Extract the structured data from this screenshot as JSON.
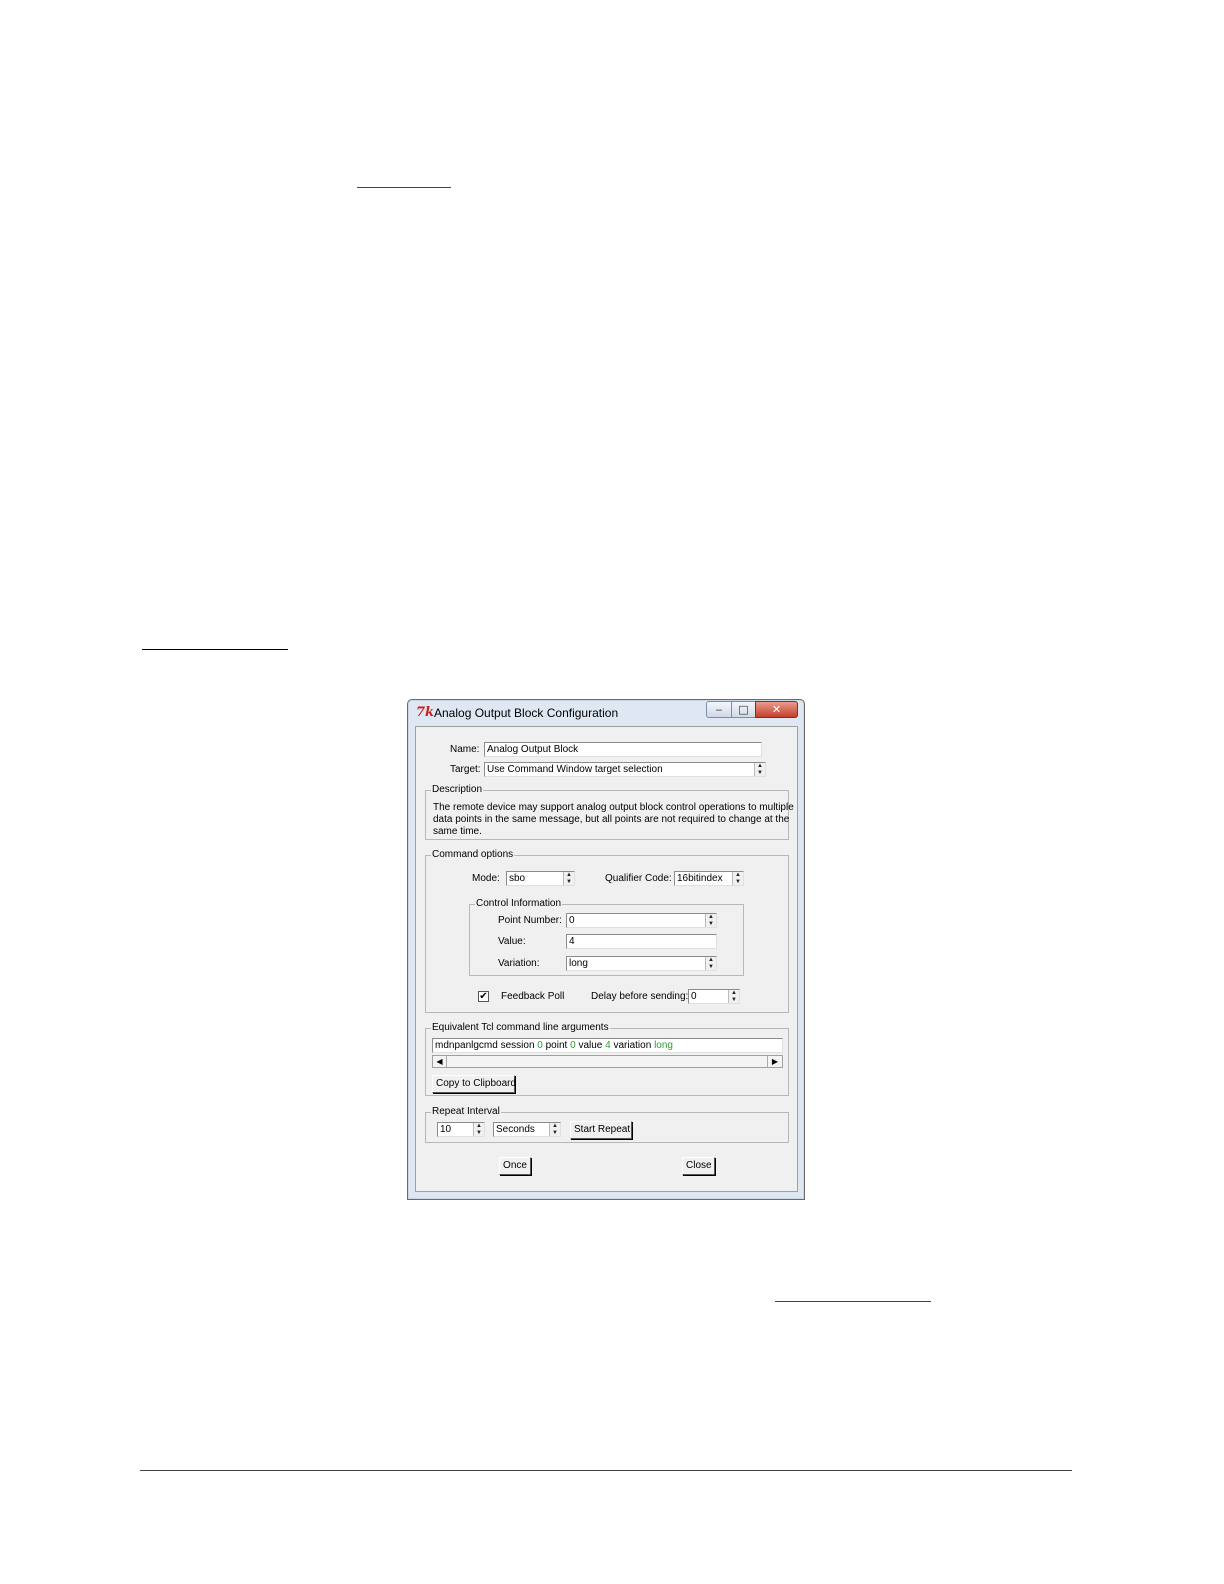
{
  "window": {
    "title": "Analog Output Block Configuration",
    "icon": "tk-feather-icon",
    "controls": {
      "minimize": "‒",
      "maximize": "□",
      "close": "✕"
    }
  },
  "form": {
    "name_label": "Name:",
    "name_value": "Analog Output Block",
    "target_label": "Target:",
    "target_value": "Use Command Window target selection"
  },
  "description": {
    "title": "Description",
    "lines": [
      "The remote device may support analog output block control operations to multiple",
      "data points  in the same message, but all points are not required to change at the",
      "same time."
    ]
  },
  "command_options": {
    "title": "Command options",
    "mode_label": "Mode:",
    "mode_value": "sbo",
    "qualifier_label": "Qualifier Code:",
    "qualifier_value": "16bitindex",
    "control_info": {
      "title": "Control Information",
      "point_label": "Point Number:",
      "point_value": "0",
      "value_label": "Value:",
      "value_value": "4",
      "variation_label": "Variation:",
      "variation_value": "long"
    },
    "feedback_poll_label": "Feedback Poll",
    "feedback_poll_checked": "✔",
    "delay_label": "Delay before sending:",
    "delay_value": "0"
  },
  "tcl": {
    "title": "Equivalent Tcl command line arguments",
    "cmd": "mdnpanlgcmd",
    "session_kw": "session",
    "session_val": "0",
    "point_kw": "point",
    "point_val": "0",
    "value_kw": "value",
    "value_val": "4",
    "variation_kw": "variation",
    "variation_val": "long",
    "copy_label": "Copy to Clipboard",
    "highlight_color": "#2ca02c"
  },
  "repeat": {
    "title": "Repeat Interval",
    "interval_value": "10",
    "unit_value": "Seconds",
    "start_label": "Start Repeat"
  },
  "buttons": {
    "once": "Once",
    "close": "Close"
  }
}
